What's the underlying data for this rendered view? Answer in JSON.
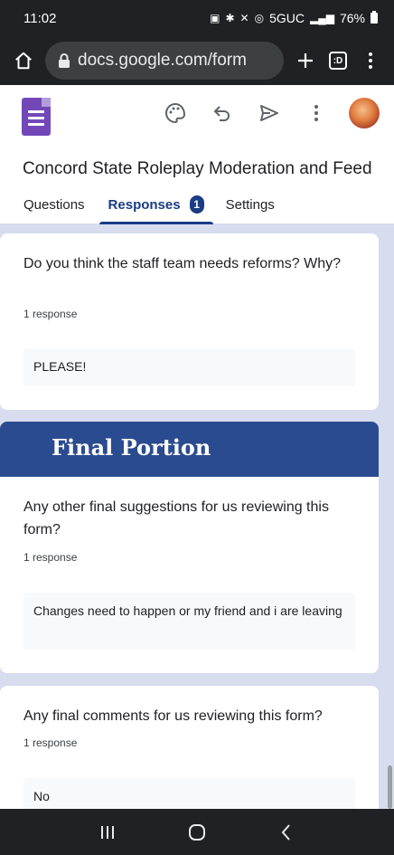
{
  "status_bar": {
    "time": "11:02",
    "network": "5GUC",
    "battery": "76%",
    "icons": [
      "battery-saver-icon",
      "bluetooth-icon",
      "mute-icon",
      "hotspot-icon",
      "signal-icon",
      "battery-icon"
    ]
  },
  "browser": {
    "url": "docs.google.com/form",
    "tab_count": ":D",
    "icons": [
      "home-icon",
      "lock-icon",
      "new-tab-icon",
      "tabs-icon",
      "menu-icon"
    ]
  },
  "header": {
    "form_title": "Concord State Roleplay Moderation and Feedback",
    "icons": [
      "palette-icon",
      "undo-icon",
      "send-icon",
      "more-icon"
    ],
    "tabs": [
      {
        "label": "Questions"
      },
      {
        "label": "Responses",
        "badge": "1"
      },
      {
        "label": "Settings"
      }
    ]
  },
  "cards": [
    {
      "question": "Do you think the staff team needs reforms? Why?",
      "count": "1 response",
      "answer": "PLEASE!"
    },
    {
      "section_title": "Final Portion",
      "question": "Any other final suggestions for us reviewing this form?",
      "count": "1 response",
      "answer": "Changes need to happen or my friend and i are leaving"
    },
    {
      "question": "Any final comments for us reviewing this form?",
      "count": "1 response",
      "answer": "No"
    }
  ],
  "colors": {
    "accent": "#1a3c85",
    "section_header": "#2a4b8f",
    "page_background": "#d7dcef",
    "forms_purple": "#7248b9"
  },
  "nav_bar": {
    "icons": [
      "recent-apps-icon",
      "home-button-icon",
      "back-icon"
    ]
  }
}
